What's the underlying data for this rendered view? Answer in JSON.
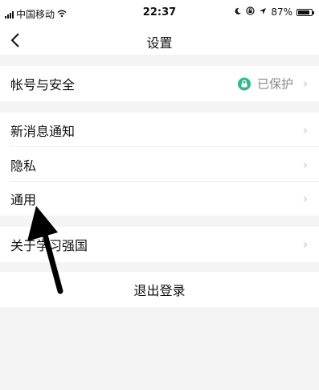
{
  "status_bar": {
    "carrier": "中国移动",
    "time": "22:37",
    "battery_percent": "87%",
    "battery_level": 0.87
  },
  "nav": {
    "title": "设置",
    "back_icon": "chevron-left-icon"
  },
  "sections": {
    "account": {
      "label": "帐号与安全",
      "status": "已保护",
      "status_color": "#2fb88a"
    },
    "notifications": {
      "label": "新消息通知"
    },
    "privacy": {
      "label": "隐私"
    },
    "general": {
      "label": "通用"
    },
    "about": {
      "label": "关于学习强国"
    }
  },
  "logout": {
    "label": "退出登录"
  },
  "chevron": "›"
}
